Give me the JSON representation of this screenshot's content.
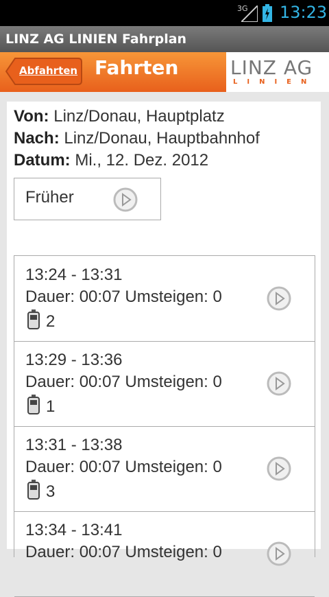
{
  "status": {
    "network": "3G",
    "time": "13:23"
  },
  "app": {
    "title": "LINZ AG LINIEN Fahrplan"
  },
  "header": {
    "back_label": "Abfahrten",
    "title": "Fahrten",
    "logo_top": "LINZ AG",
    "logo_bottom": "LINIEN"
  },
  "info": {
    "from_label": "Von:",
    "from_value": "Linz/Donau, Hauptplatz",
    "to_label": "Nach:",
    "to_value": "Linz/Donau, Hauptbahnhof",
    "date_label": "Datum:",
    "date_value": "Mi., 12. Dez.  2012"
  },
  "earlier": {
    "label": "Früher"
  },
  "connections": [
    {
      "time": "13:24 - 13:31",
      "details": "Dauer: 00:07 Umsteigen: 0",
      "line": "2"
    },
    {
      "time": "13:29 - 13:36",
      "details": "Dauer: 00:07 Umsteigen: 0",
      "line": "1"
    },
    {
      "time": "13:31 - 13:38",
      "details": "Dauer: 00:07 Umsteigen: 0",
      "line": "3"
    },
    {
      "time": "13:34 - 13:41",
      "details": "Dauer: 00:07 Umsteigen: 0",
      "line": ""
    }
  ],
  "colors": {
    "accent": "#e8601c",
    "status_text": "#33b5e5"
  },
  "icons": {
    "go": "play-circle-icon",
    "vehicle": "tram-icon"
  }
}
